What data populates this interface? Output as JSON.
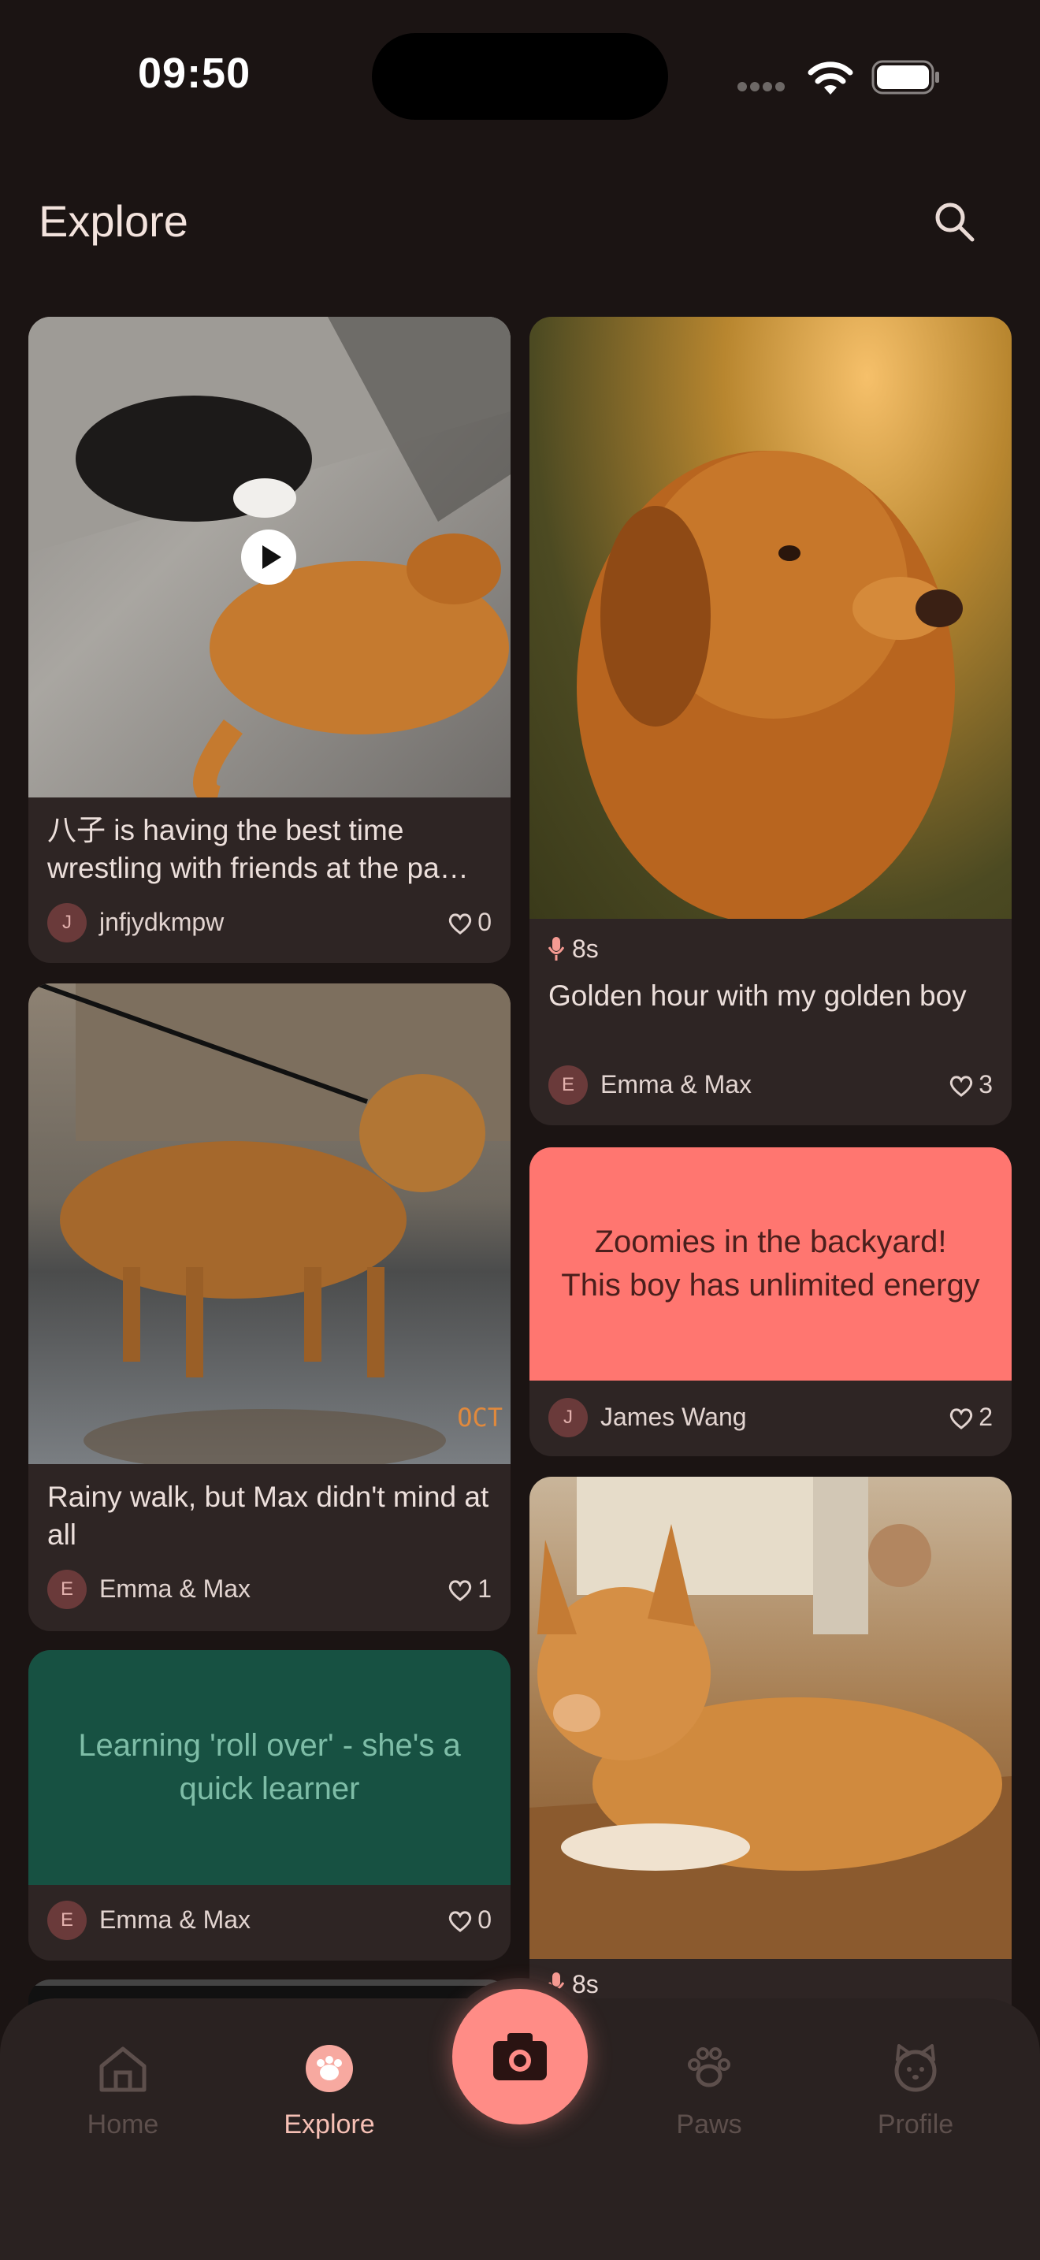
{
  "status": {
    "time": "09:50"
  },
  "header": {
    "title": "Explore"
  },
  "posts": [
    {
      "caption": "八子 is having the best time wrestling with friends at the pa…",
      "avatar_initial": "J",
      "author": "jnfjydkmpw",
      "likes": "0",
      "media": "video"
    },
    {
      "audio_duration": "8s",
      "caption": "Golden hour with my golden boy",
      "avatar_initial": "E",
      "author": "Emma & Max",
      "likes": "3"
    },
    {
      "caption": "Rainy walk, but Max didn't mind at all",
      "avatar_initial": "E",
      "author": "Emma & Max",
      "likes": "1",
      "overlay_text": "OCT"
    },
    {
      "text": "Zoomies in the backyard! This boy has unlimited energy",
      "bg": "#ff7670",
      "avatar_initial": "J",
      "author": "James Wang",
      "likes": "2"
    },
    {
      "text": "Learning 'roll over' - she's a quick learner",
      "bg": "#175142",
      "avatar_initial": "E",
      "author": "Emma & Max",
      "likes": "0"
    },
    {
      "audio_duration": "8s"
    }
  ],
  "nav": {
    "items": [
      {
        "label": "Home",
        "icon": "home-icon"
      },
      {
        "label": "Explore",
        "icon": "explore-icon",
        "active": true
      },
      {
        "label": "Paws",
        "icon": "paw-icon"
      },
      {
        "label": "Profile",
        "icon": "profile-icon"
      }
    ],
    "fab_icon": "camera-icon"
  },
  "colors": {
    "background": "#1b1413",
    "card": "#2e2524",
    "accent": "#ff8c86",
    "active_label": "#f6c0b5"
  }
}
